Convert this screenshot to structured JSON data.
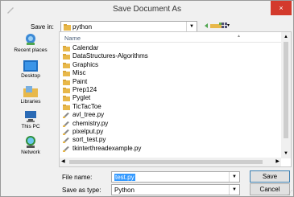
{
  "window": {
    "title": "Save Document As",
    "close_label": "×"
  },
  "save_in": {
    "label": "Save in:",
    "value": "python"
  },
  "toolbar": {
    "view_menu_label": "▾"
  },
  "places": [
    {
      "label": "Recent places",
      "icon": "recent-places-icon"
    },
    {
      "label": "Desktop",
      "icon": "desktop-icon"
    },
    {
      "label": "Libraries",
      "icon": "libraries-icon"
    },
    {
      "label": "This PC",
      "icon": "computer-icon"
    },
    {
      "label": "Network",
      "icon": "network-icon"
    }
  ],
  "list": {
    "column_name": "Name",
    "items": [
      {
        "name": "Calendar",
        "type": "folder"
      },
      {
        "name": "DataStructures-Algorithms",
        "type": "folder"
      },
      {
        "name": "Graphics",
        "type": "folder"
      },
      {
        "name": "Misc",
        "type": "folder"
      },
      {
        "name": "Paint",
        "type": "folder"
      },
      {
        "name": "Prep124",
        "type": "folder"
      },
      {
        "name": "Pyglet",
        "type": "folder"
      },
      {
        "name": "TicTacToe",
        "type": "folder"
      },
      {
        "name": "avl_tree.py",
        "type": "file"
      },
      {
        "name": "chemistry.py",
        "type": "file"
      },
      {
        "name": "pixelput.py",
        "type": "file"
      },
      {
        "name": "sort_test.py",
        "type": "file"
      },
      {
        "name": "tkinterthreadexample.py",
        "type": "file"
      }
    ]
  },
  "filename": {
    "label": "File name:",
    "value": "test.py"
  },
  "filetype": {
    "label": "Save as type:",
    "value": "Python"
  },
  "buttons": {
    "save": "Save",
    "cancel": "Cancel"
  },
  "colors": {
    "folder": "#e8b84a",
    "selection": "#3399ff",
    "close": "#d33a2c"
  }
}
